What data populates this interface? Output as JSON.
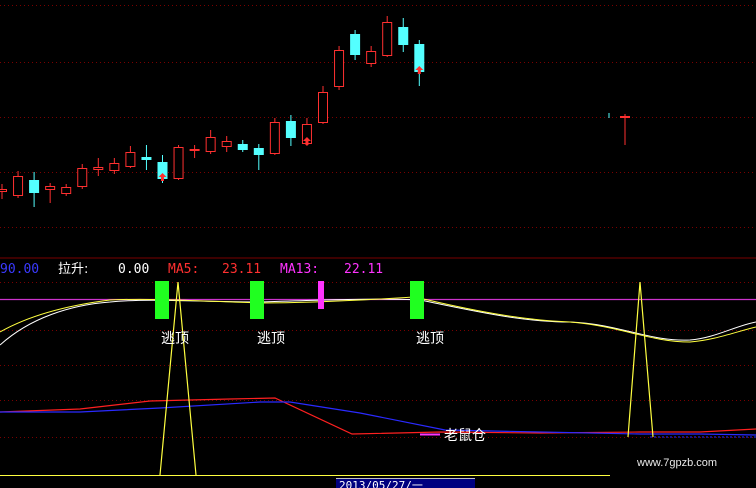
{
  "colors": {
    "up": "#ff3030",
    "down": "#54ffff",
    "ma_white": "#ffffff",
    "ma_yellow": "#ffff40",
    "signal_green": "#20ff20",
    "signal_magenta": "#ff33ff",
    "level_line": "#cc33cc",
    "red_line": "#ff2020",
    "blue_line": "#2a2aff",
    "grid": "#7a0000"
  },
  "indicator": {
    "value0": "90.00",
    "pull_label": "拉升:",
    "pull_value": "0.00",
    "ma5_label": "MA5:",
    "ma5_value": "23.11",
    "ma13_label": "MA13:",
    "ma13_value": "22.11"
  },
  "signals": [
    "逃顶",
    "逃顶",
    "逃顶"
  ],
  "mouse_label": "老鼠仓",
  "watermark": "www.7gpzb.com",
  "date_label": "2013/05/27/一",
  "candles": [
    {
      "o": 191,
      "c": 189,
      "h": 184,
      "l": 199,
      "dir": "up"
    },
    {
      "o": 195,
      "c": 176,
      "h": 171,
      "l": 198,
      "dir": "up"
    },
    {
      "o": 180,
      "c": 193,
      "h": 172,
      "l": 207,
      "dir": "down"
    },
    {
      "o": 189,
      "c": 186,
      "h": 183,
      "l": 203,
      "dir": "up"
    },
    {
      "o": 193,
      "c": 187,
      "h": 184,
      "l": 196,
      "dir": "up"
    },
    {
      "o": 186,
      "c": 168,
      "h": 164,
      "l": 189,
      "dir": "up"
    },
    {
      "o": 169,
      "c": 167,
      "h": 158,
      "l": 176,
      "dir": "up"
    },
    {
      "o": 170,
      "c": 163,
      "h": 158,
      "l": 174,
      "dir": "up"
    },
    {
      "o": 166,
      "c": 152,
      "h": 146,
      "l": 168,
      "dir": "up"
    },
    {
      "o": 157,
      "c": 160,
      "h": 145,
      "l": 170,
      "dir": "down"
    },
    {
      "o": 162,
      "c": 179,
      "h": 155,
      "l": 183,
      "dir": "down"
    },
    {
      "o": 178,
      "c": 147,
      "h": 145,
      "l": 180,
      "dir": "up"
    },
    {
      "o": 150,
      "c": 149,
      "h": 145,
      "l": 158,
      "dir": "up"
    },
    {
      "o": 151,
      "c": 137,
      "h": 130,
      "l": 154,
      "dir": "up"
    },
    {
      "o": 146,
      "c": 141,
      "h": 136,
      "l": 152,
      "dir": "up"
    },
    {
      "o": 144,
      "c": 150,
      "h": 140,
      "l": 152,
      "dir": "down"
    },
    {
      "o": 148,
      "c": 155,
      "h": 144,
      "l": 170,
      "dir": "down"
    },
    {
      "o": 153,
      "c": 122,
      "h": 118,
      "l": 155,
      "dir": "up"
    },
    {
      "o": 121,
      "c": 138,
      "h": 115,
      "l": 146,
      "dir": "down"
    },
    {
      "o": 143,
      "c": 124,
      "h": 118,
      "l": 146,
      "dir": "up"
    },
    {
      "o": 122,
      "c": 92,
      "h": 86,
      "l": 124,
      "dir": "up"
    },
    {
      "o": 86,
      "c": 50,
      "h": 46,
      "l": 90,
      "dir": "up"
    },
    {
      "o": 34,
      "c": 55,
      "h": 30,
      "l": 60,
      "dir": "down"
    },
    {
      "o": 63,
      "c": 51,
      "h": 46,
      "l": 67,
      "dir": "up"
    },
    {
      "o": 55,
      "c": 22,
      "h": 16,
      "l": 57,
      "dir": "up"
    },
    {
      "o": 27,
      "c": 45,
      "h": 18,
      "l": 52,
      "dir": "down"
    },
    {
      "o": 44,
      "c": 72,
      "h": 40,
      "l": 86,
      "dir": "down"
    }
  ],
  "arrows": [
    10,
    19,
    26
  ],
  "lone_candle": {
    "o": 116,
    "c": 116,
    "h": 114,
    "l": 145,
    "dir": "up"
  }
}
